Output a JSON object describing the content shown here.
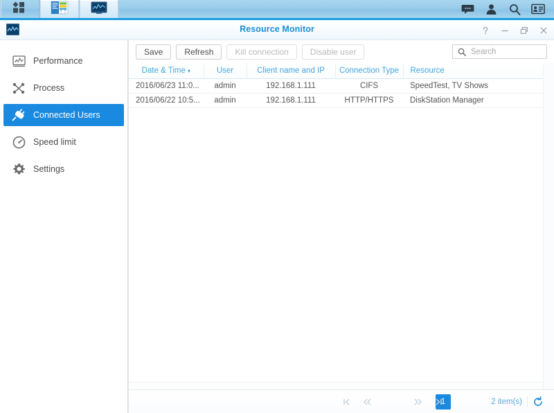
{
  "taskbar": {
    "left_buttons": [
      {
        "name": "main-menu-icon",
        "label": "Main Menu"
      },
      {
        "name": "package-center-icon",
        "label": "Package Center"
      },
      {
        "name": "resource-monitor-icon",
        "label": "Resource Monitor"
      }
    ],
    "right_icons": [
      {
        "name": "notifications-icon",
        "label": "Notifications"
      },
      {
        "name": "user-options-icon",
        "label": "Options"
      },
      {
        "name": "search-icon",
        "label": "Search"
      },
      {
        "name": "widgets-icon",
        "label": "Widgets"
      }
    ]
  },
  "window": {
    "title": "Resource Monitor",
    "icon_name": "resource-monitor-window-icon",
    "controls": [
      {
        "name": "help-button",
        "glyph": "?"
      },
      {
        "name": "minimize-button",
        "glyph": "–"
      },
      {
        "name": "maximize-button",
        "glyph": "❐"
      },
      {
        "name": "close-button",
        "glyph": "×"
      }
    ]
  },
  "sidebar": {
    "items": [
      {
        "label": "Performance",
        "icon": "performance-chart-icon",
        "active": false
      },
      {
        "label": "Process",
        "icon": "process-icon",
        "active": false
      },
      {
        "label": "Connected Users",
        "icon": "plug-connection-icon",
        "active": true
      },
      {
        "label": "Speed limit",
        "icon": "speed-gauge-icon",
        "active": false
      },
      {
        "label": "Settings",
        "icon": "gear-icon",
        "active": false
      }
    ],
    "active_color": "#1a8ae0"
  },
  "toolbar": {
    "buttons": [
      {
        "label": "Save",
        "name": "save-button",
        "disabled": false
      },
      {
        "label": "Refresh",
        "name": "refresh-button",
        "disabled": false
      },
      {
        "label": "Kill connection",
        "name": "kill-connection-button",
        "disabled": true
      },
      {
        "label": "Disable user",
        "name": "disable-user-button",
        "disabled": true
      }
    ],
    "search": {
      "placeholder": "Search",
      "value": "",
      "icon": "search-icon"
    }
  },
  "table": {
    "columns": [
      {
        "label": "Date & Time",
        "sorted": "desc"
      },
      {
        "label": "User",
        "sorted": null
      },
      {
        "label": "Client name and IP",
        "sorted": null
      },
      {
        "label": "Connection Type",
        "sorted": null
      },
      {
        "label": "Resource",
        "sorted": null
      }
    ],
    "sort_arrow_glyph": "▾",
    "rows": [
      {
        "date_time": "2016/06/23 11:0...",
        "user": "admin",
        "client": "192.168.1.111",
        "connection_type": "CIFS",
        "resource": "SpeedTest, TV Shows"
      },
      {
        "date_time": "2016/06/22 10:5...",
        "user": "admin",
        "client": "192.168.1.111",
        "connection_type": "HTTP/HTTPS",
        "resource": "DiskStation Manager"
      }
    ]
  },
  "pager": {
    "first_glyph": "|‹",
    "prev_glyph": "«",
    "next_glyph": "»",
    "last_glyph": "›|",
    "current_page": "1",
    "item_count": "2 item(s)",
    "refresh_icon": "refresh-circular-icon"
  }
}
